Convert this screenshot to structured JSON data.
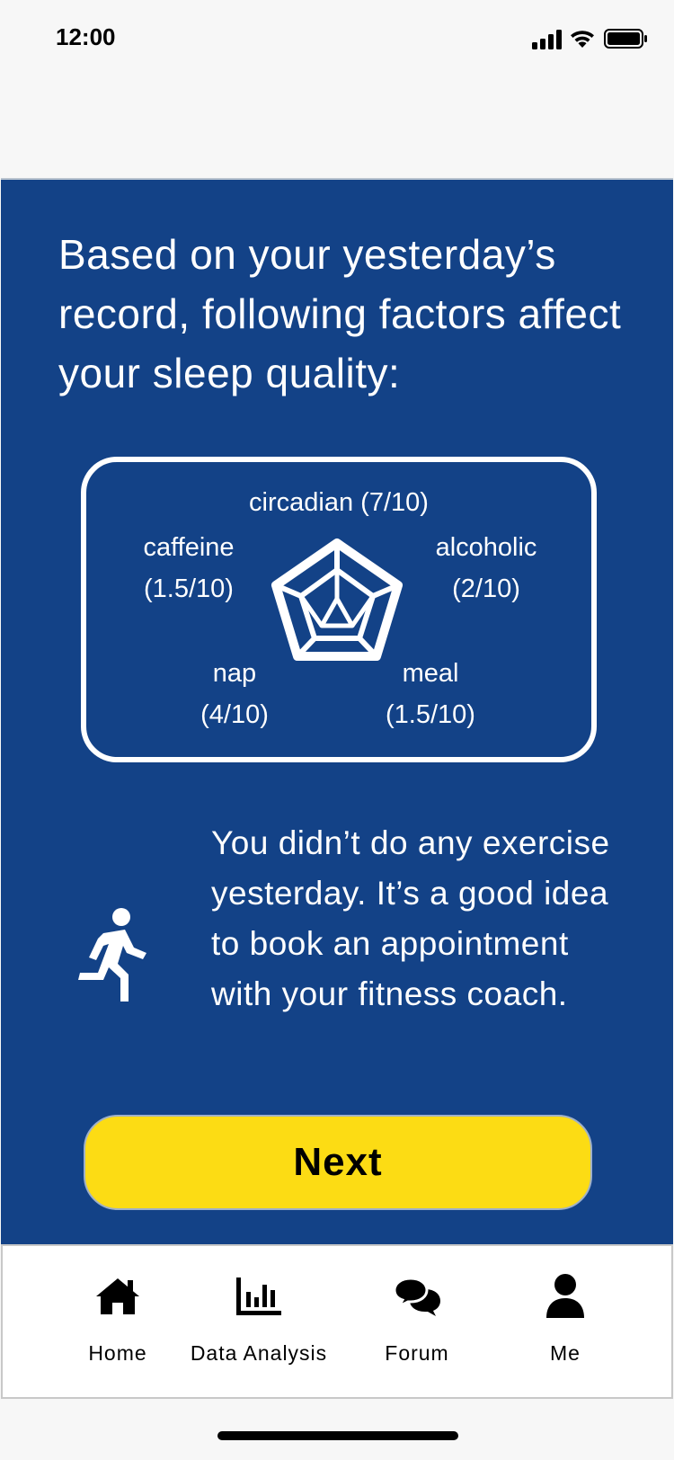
{
  "status_bar": {
    "time": "12:00",
    "icons": [
      "cellular-signal-icon",
      "wifi-icon",
      "battery-icon"
    ]
  },
  "headline": "Based on your yesterday’s record, following factors affect your sleep quality:",
  "factors": {
    "circadian": {
      "name": "circadian",
      "score": "(7/10)"
    },
    "caffeine": {
      "name": "caffeine",
      "score": "(1.5/10)"
    },
    "alcoholic": {
      "name": "alcoholic",
      "score": "(2/10)"
    },
    "nap": {
      "name": "nap",
      "score": "(4/10)"
    },
    "meal": {
      "name": "meal",
      "score": "(1.5/10)"
    }
  },
  "factor_card_icon": "radar-chart-icon",
  "exercise": {
    "icon": "running-person-icon",
    "message": "You didn’t do any exercise yesterday. It’s a good idea to book an appointment with your fitness coach."
  },
  "next_button": {
    "label": "Next"
  },
  "tab_bar": {
    "tabs": [
      {
        "label": "Home",
        "icon": "home-icon"
      },
      {
        "label": "Data Analysis",
        "icon": "bar-chart-icon"
      },
      {
        "label": "Forum",
        "icon": "chat-bubbles-icon"
      },
      {
        "label": "Me",
        "icon": "user-icon"
      }
    ]
  },
  "colors": {
    "panel_background": "#134287",
    "button_background": "#fcdc14",
    "text_on_panel": "#ffffff"
  }
}
